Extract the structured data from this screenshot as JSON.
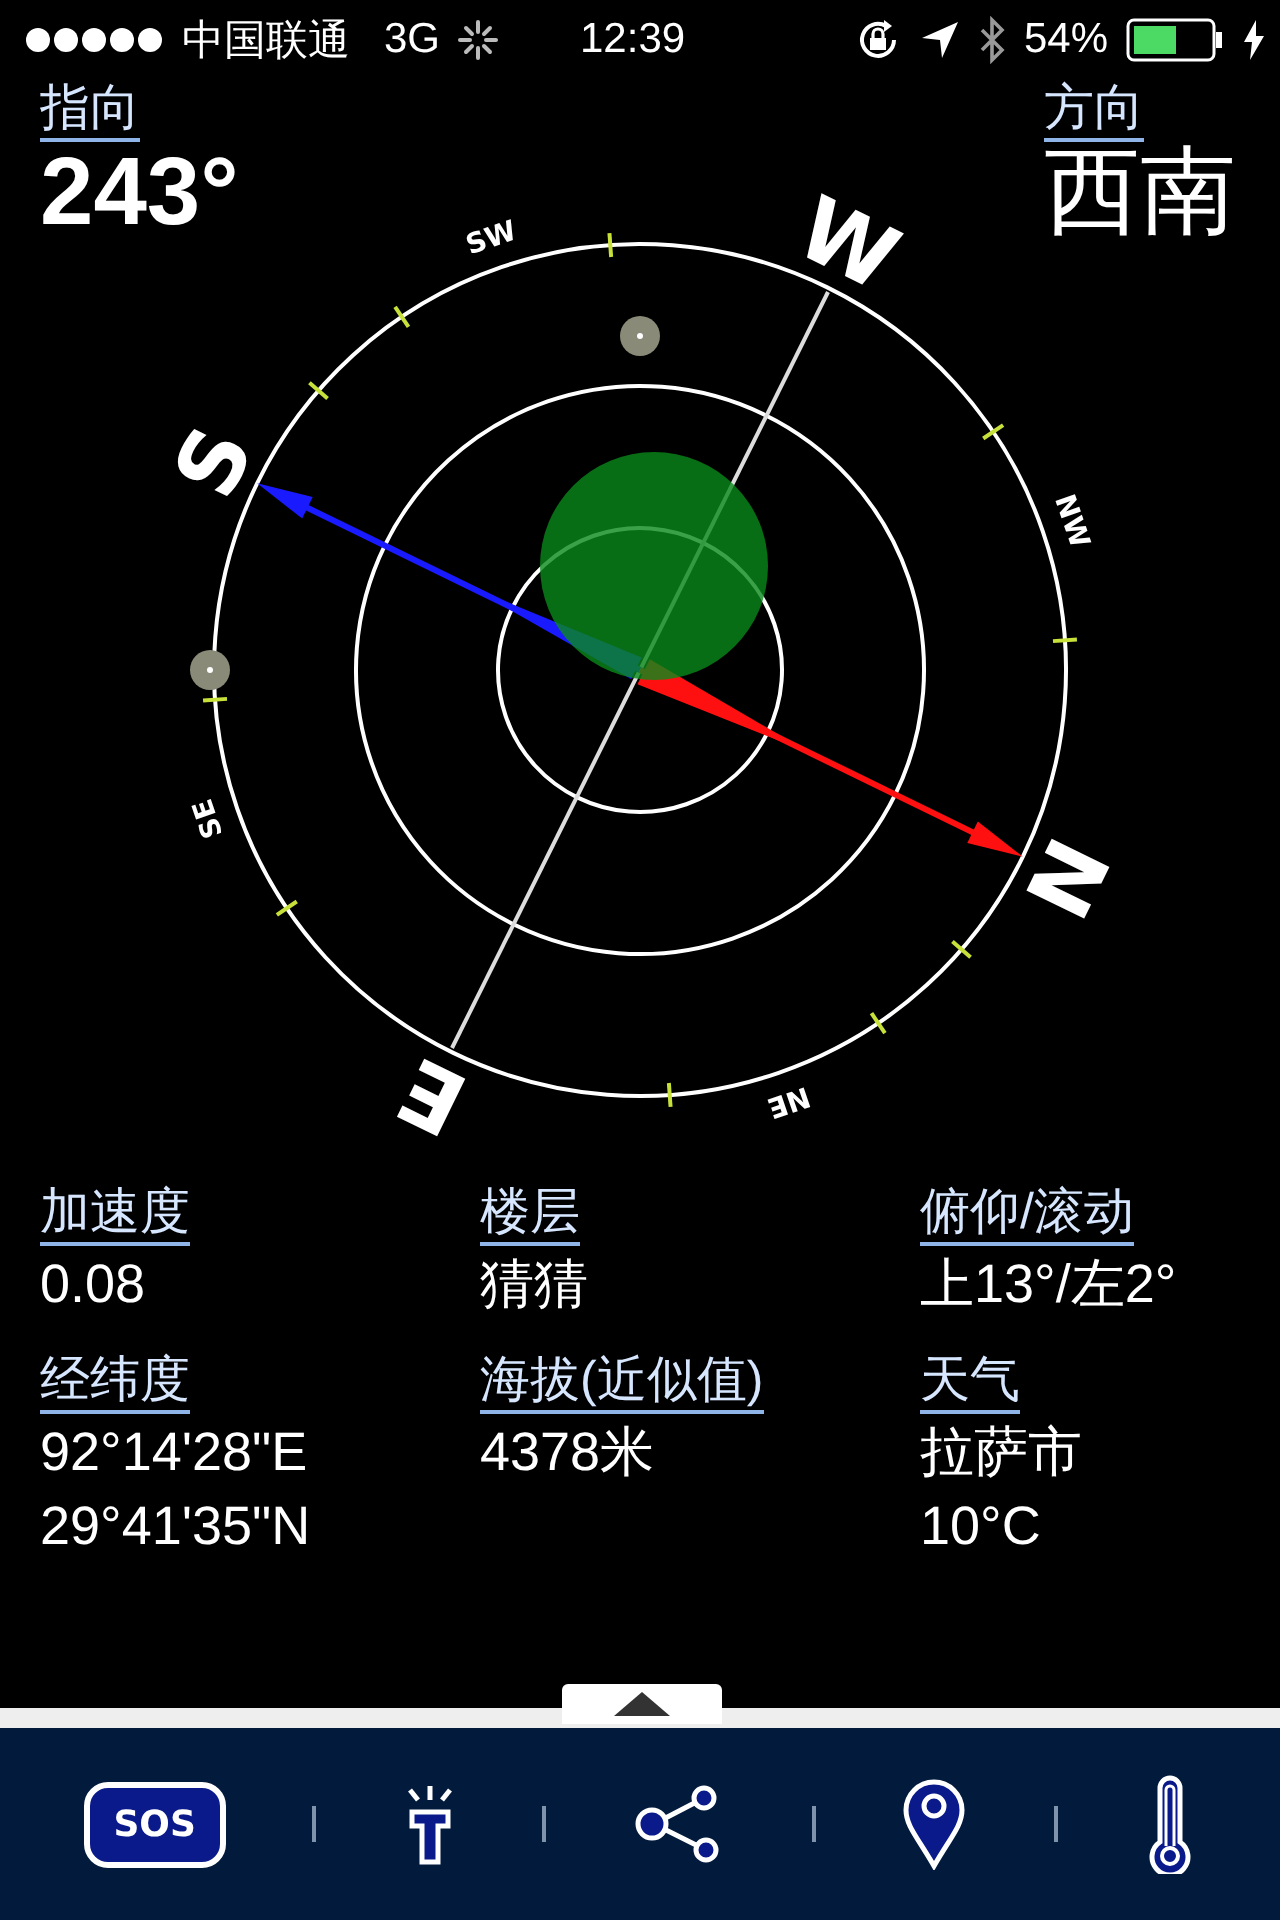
{
  "status_bar": {
    "carrier": "中国联通",
    "network": "3G",
    "time": "12:39",
    "battery": "54%"
  },
  "heading": {
    "label": "指向",
    "value": "243°"
  },
  "direction": {
    "label": "方向",
    "value": "西南"
  },
  "compass": {
    "labels": [
      {
        "text": "N",
        "kind": "cardinal"
      },
      {
        "text": "NE",
        "kind": "intercardinal"
      },
      {
        "text": "E",
        "kind": "cardinal"
      },
      {
        "text": "SE",
        "kind": "intercardinal"
      },
      {
        "text": "S",
        "kind": "cardinal"
      },
      {
        "text": "SW",
        "kind": "intercardinal"
      },
      {
        "text": "W",
        "kind": "cardinal"
      },
      {
        "text": "NW",
        "kind": "intercardinal"
      }
    ]
  },
  "info": [
    {
      "label": "加速度",
      "lines": [
        "0.08"
      ]
    },
    {
      "label": "楼层",
      "lines": [
        "猜猜"
      ]
    },
    {
      "label": "俯仰/滚动",
      "lines": [
        "上13°/左2°"
      ]
    },
    {
      "label": "经纬度",
      "lines": [
        "92°14'28\"E",
        "29°41'35\"N"
      ]
    },
    {
      "label": "海拔(近似值)",
      "lines": [
        "4378米"
      ]
    },
    {
      "label": "天气",
      "lines": [
        "拉萨市",
        "10°C"
      ]
    }
  ],
  "toolbar": [
    {
      "kind": "sos",
      "label": "SOS"
    },
    {
      "kind": "flashlight"
    },
    {
      "kind": "share"
    },
    {
      "kind": "location"
    },
    {
      "kind": "thermometer"
    }
  ]
}
